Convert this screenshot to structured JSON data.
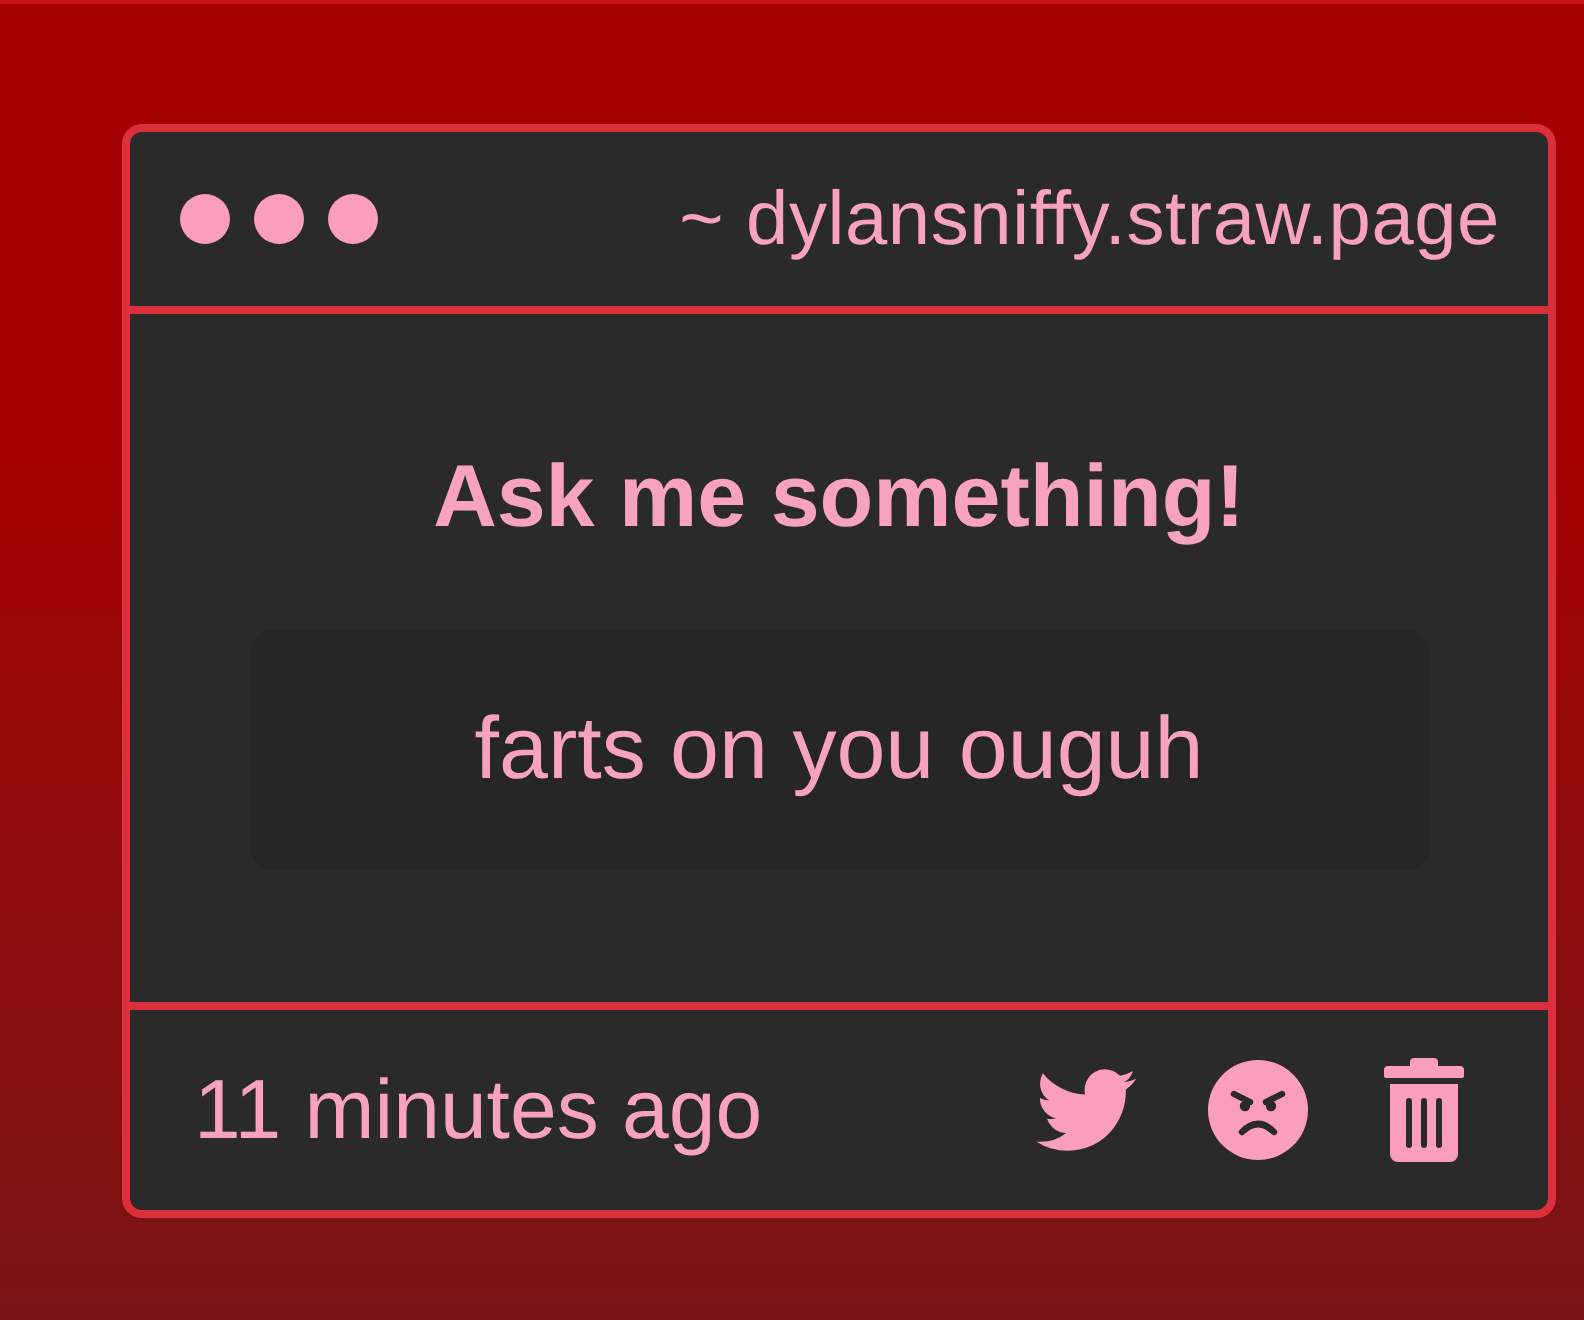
{
  "window": {
    "title": "~ dylansniffy.straw.page"
  },
  "prompt": {
    "heading": "Ask me something!",
    "question": "farts on you ouguh"
  },
  "footer": {
    "time": "11 minutes ago",
    "actions": [
      {
        "kind": "share"
      },
      {
        "kind": "react"
      },
      {
        "kind": "delete"
      }
    ]
  }
}
